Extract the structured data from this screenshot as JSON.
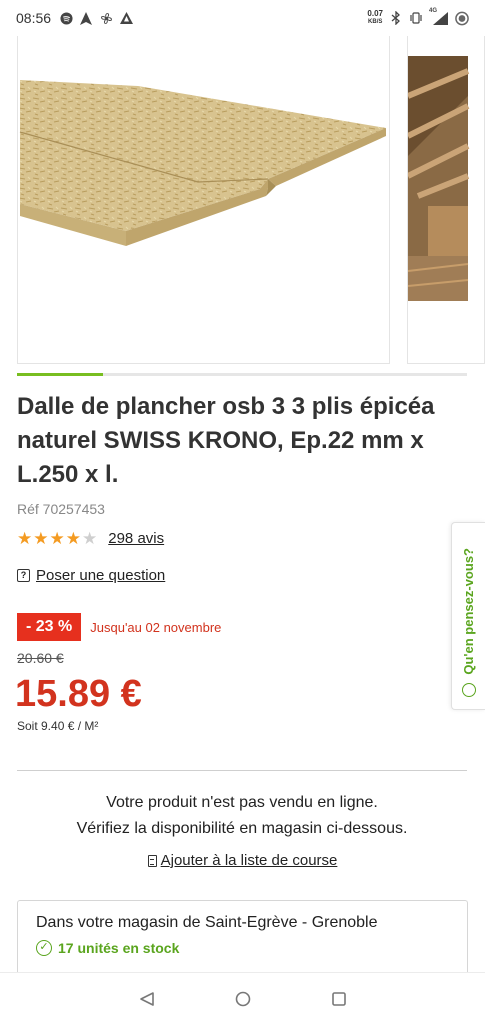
{
  "status_bar": {
    "time": "08:56",
    "net_speed_value": "0.07",
    "net_speed_unit": "KB/S",
    "network_label": "4G"
  },
  "gallery": {
    "active_index": 0,
    "progress_fraction": 0.19
  },
  "product": {
    "title": "Dalle de plancher osb 3 3 plis épicéa naturel SWISS KRONO, Ep.22 mm x L.250 x l.",
    "ref": "Réf 70257453",
    "rating": 4,
    "rating_max": 5,
    "reviews": "298 avis",
    "question_link": "Poser une question"
  },
  "pricing": {
    "discount_badge": "- 23 %",
    "promo_until": "Jusqu'au 02 novembre",
    "old_price": "20.60 €",
    "price": "15.89 €",
    "unit_price": "Soit 9.40 € / M²"
  },
  "availability": {
    "notice_line1": "Votre produit n'est pas vendu en ligne.",
    "notice_line2": "Vérifiez la disponibilité en magasin ci-dessous.",
    "shopping_list_link": "Ajouter à la liste de course",
    "store_name": "Dans votre magasin de Saint-Egrève - Grenoble",
    "stock": "17 unités en stock"
  },
  "feedback": {
    "label": "Qu'en pensez-vous?"
  },
  "colors": {
    "accent_green": "#78be20",
    "price_red": "#d2331e",
    "badge_red": "#e6301e",
    "star_orange": "#f49b22"
  }
}
